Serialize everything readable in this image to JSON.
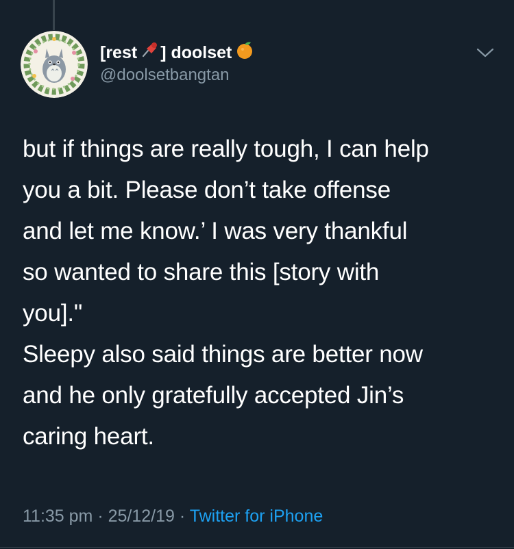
{
  "tweet": {
    "author": {
      "name_prefix": "[rest",
      "name_suffix": "] doolset",
      "pin_emoji": "pushpin-icon",
      "orange_emoji": "tangerine-icon",
      "handle": "@doolsetbangtan",
      "avatar": "totoro-wreath-avatar"
    },
    "lines": [
      "but if things are really tough, I can help",
      "you a bit. Please don’t take offense",
      "and let me know.’ I was very thankful",
      "so wanted to share this [story with",
      "you].\"",
      "Sleepy also said things are better now",
      "and he only gratefully accepted Jin’s",
      "caring heart."
    ],
    "meta": {
      "time": "11:35 pm",
      "separator": "·",
      "date": "25/12/19",
      "source": "Twitter for iPhone"
    }
  },
  "colors": {
    "background": "#15202b",
    "text": "#ffffff",
    "secondary": "#8899a6",
    "link": "#1da1f2",
    "divider": "#38444d"
  }
}
